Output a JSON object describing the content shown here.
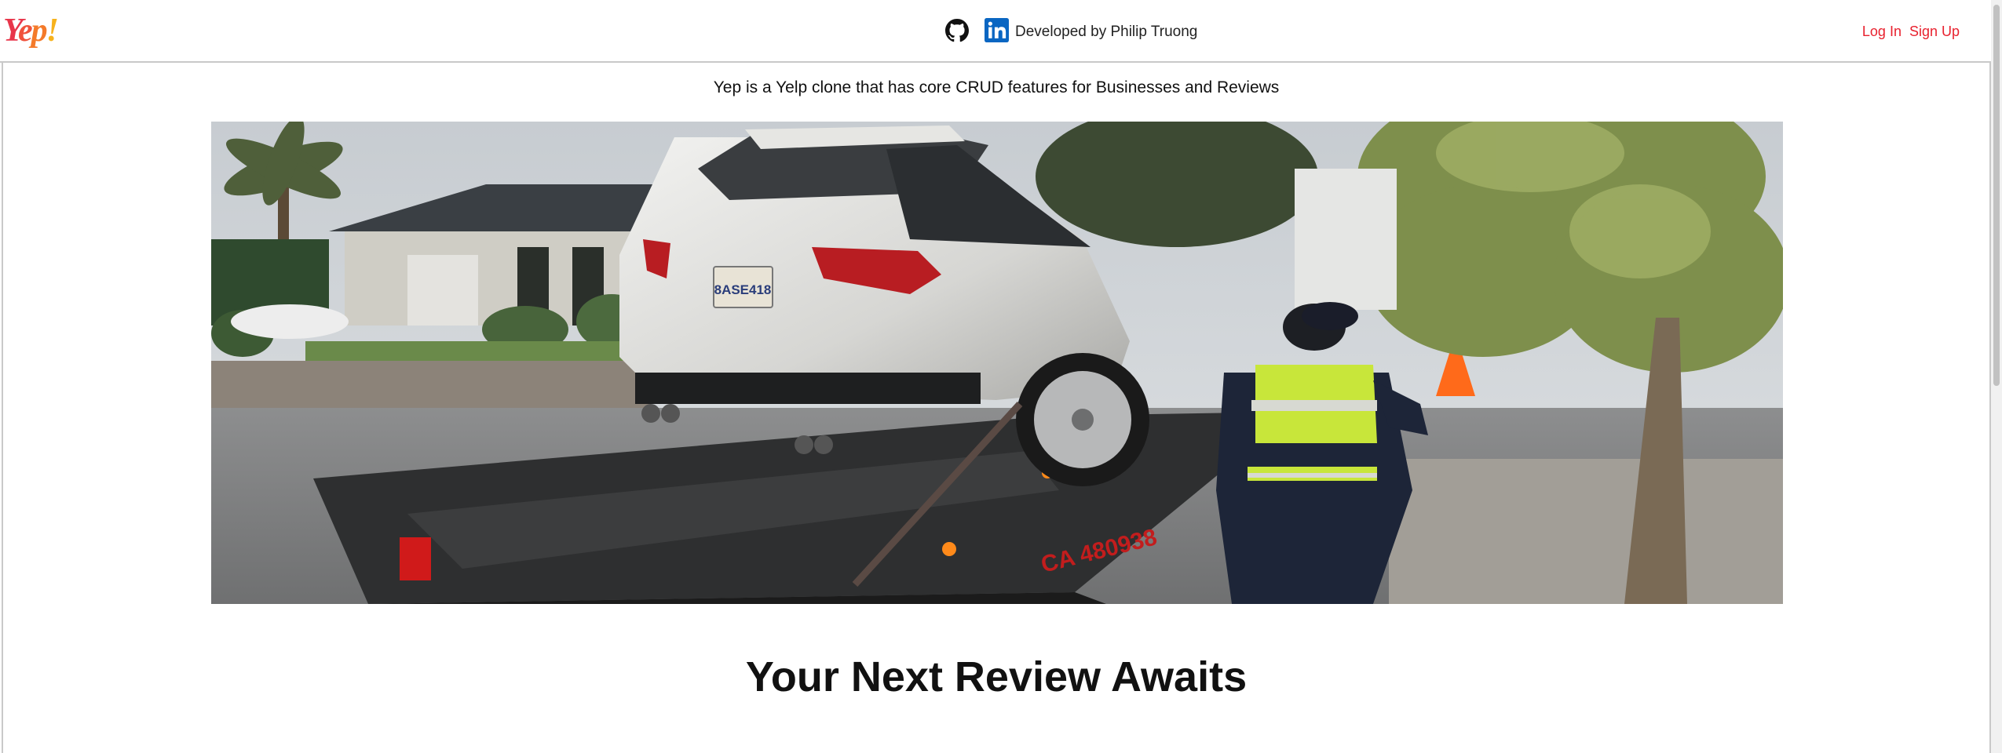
{
  "nav": {
    "logo_text": "Yep!",
    "github_icon": "github-icon",
    "linkedin_icon": "linkedin-icon",
    "developer_text": "Developed by Philip Truong",
    "login_label": "Log In",
    "signup_label": "Sign Up"
  },
  "main": {
    "tagline": "Yep is a Yelp clone that has core CRUD features for Businesses and Reviews",
    "hero": {
      "plate_text": "8ASE418",
      "truck_text": "CA 480938"
    },
    "headline": "Your Next Review Awaits"
  },
  "colors": {
    "accent": "#e8212e",
    "linkedin": "#0a66c2",
    "border": "#c9c9c9"
  }
}
